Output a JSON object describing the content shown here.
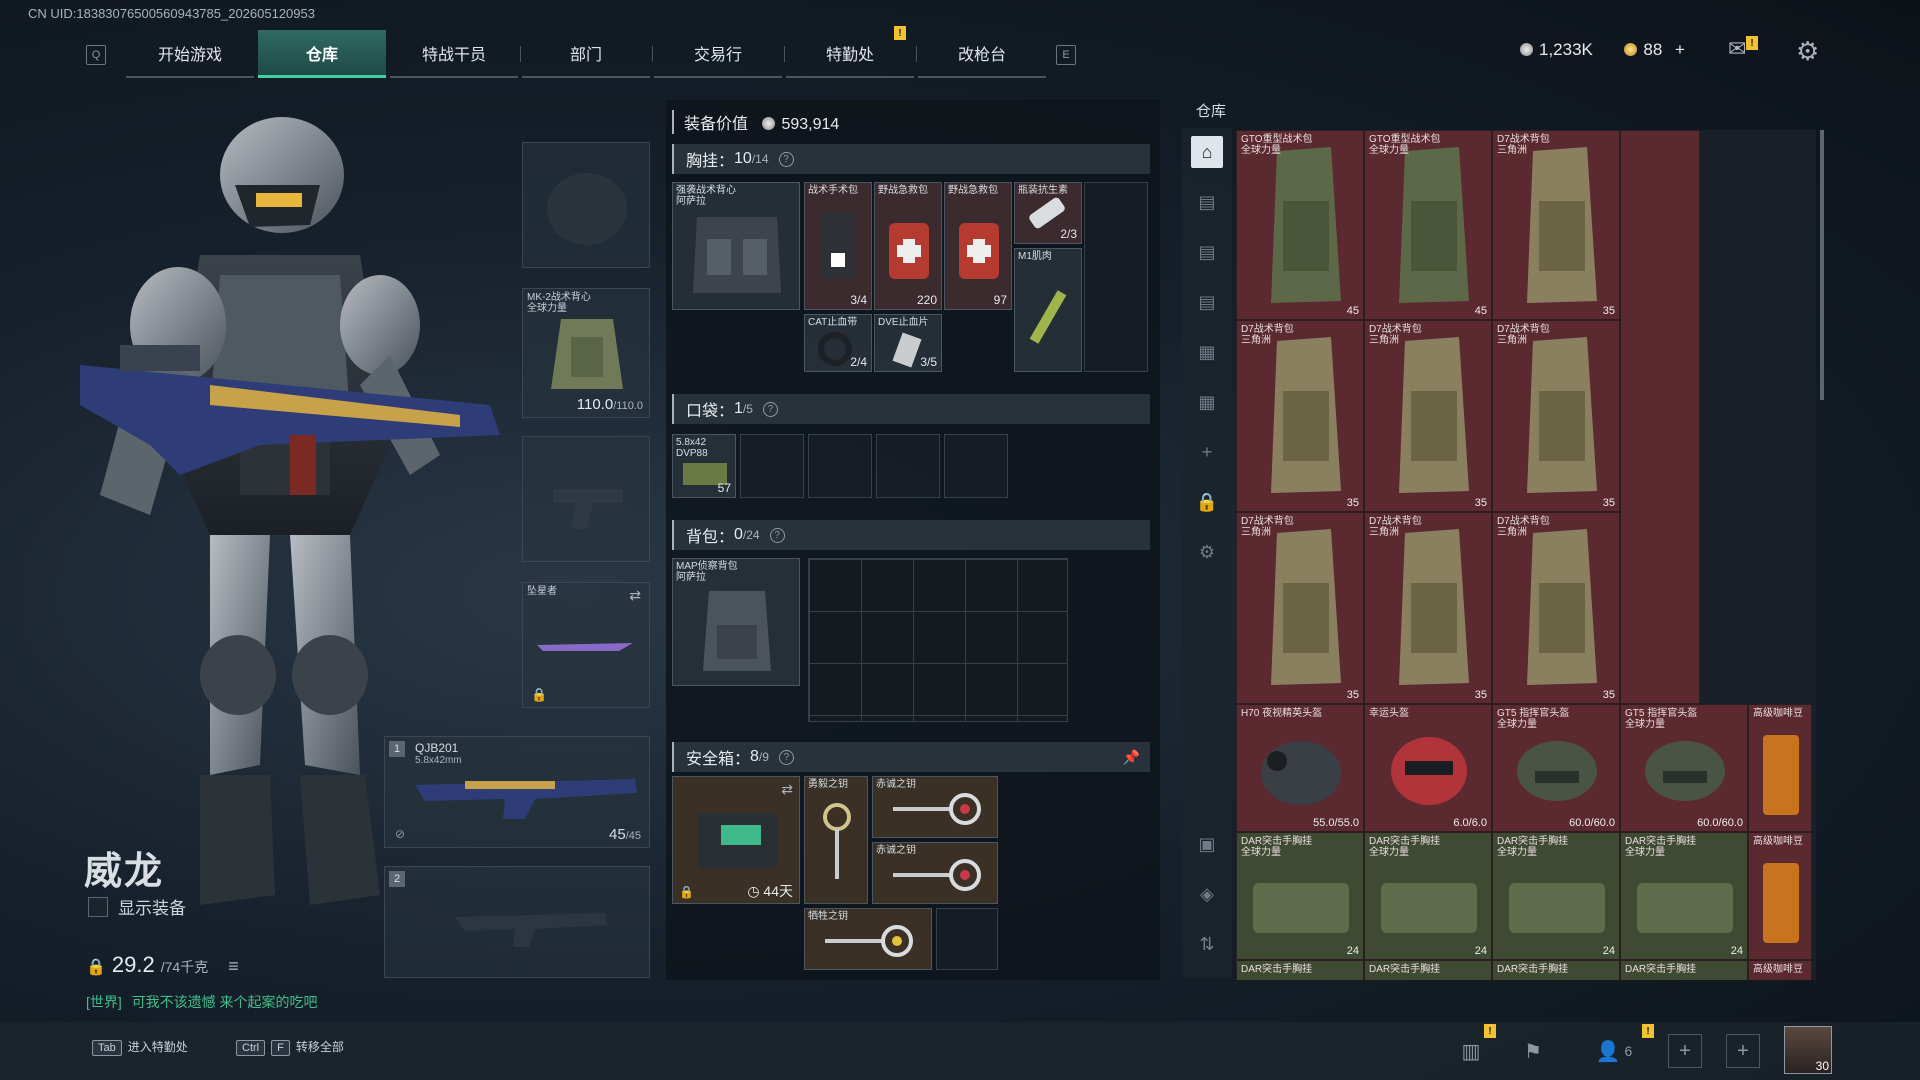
{
  "uid": "CN UID:18383076500560943785_202605120953",
  "nav": {
    "left_key": "Q",
    "right_key": "E",
    "tabs": [
      "开始游戏",
      "仓库",
      "特战干员",
      "部门",
      "交易行",
      "特勤处",
      "改枪台"
    ],
    "active": "仓库"
  },
  "currency": {
    "silver": "1,233K",
    "gold": "88",
    "plus": "+"
  },
  "character": {
    "name": "威龙",
    "show_equipment": "显示装备",
    "weight": "29.2",
    "weight_max": "/74千克",
    "chat_channel": "[世界]",
    "chat_text": "可我不该遗憾 来个起案的吃吧"
  },
  "equip_slots": {
    "vest_name": "MK-2战术背心\n全球力量",
    "vest_durability": "110.0",
    "vest_durability_max": "/110.0",
    "melee_name": "坠星者",
    "primary_index": "1",
    "primary_name": "QJB201",
    "primary_caliber": "5.8x42mm",
    "primary_ammo": "45",
    "primary_ammo_max": "/45",
    "secondary_index": "2"
  },
  "equip_value": {
    "label": "装备价值",
    "value": "593,914"
  },
  "chest": {
    "label": "胸挂：",
    "used": "10",
    "cap": "/14",
    "rig_name": "强袭战术背心\n阿萨拉",
    "items": [
      {
        "name": "战术手术包",
        "count": "3/4"
      },
      {
        "name": "野战急救包",
        "count": "220"
      },
      {
        "name": "野战急救包",
        "count": "97"
      },
      {
        "name": "瓶装抗生素",
        "count": "2/3"
      },
      {
        "name": "CAT止血带",
        "count": "2/4"
      },
      {
        "name": "DVE止血片",
        "count": "3/5"
      },
      {
        "name": "M1肌肉",
        "count": ""
      }
    ]
  },
  "pocket": {
    "label": "口袋：",
    "used": "1",
    "cap": "/5",
    "ammo_name": "5.8x42\nDVP88",
    "ammo_count": "57"
  },
  "backpack": {
    "label": "背包：",
    "used": "0",
    "cap": "/24",
    "bag_name": "MAP侦察背包\n阿萨拉"
  },
  "safebox": {
    "label": "安全箱：",
    "used": "8",
    "cap": "/9",
    "days": "44天",
    "keys": [
      "勇毅之钥",
      "赤诚之钥",
      "赤诚之钥",
      "牺牲之钥"
    ]
  },
  "warehouse": {
    "title": "仓库",
    "rows": [
      [
        {
          "name": "GTO重型战术包\n全球力量",
          "count": "45"
        },
        {
          "name": "GTO重型战术包\n全球力量",
          "count": "45"
        },
        {
          "name": "D7战术背包\n三角洲",
          "count": "35"
        }
      ],
      [
        {
          "name": "D7战术背包\n三角洲",
          "count": "35"
        },
        {
          "name": "D7战术背包\n三角洲",
          "count": "35"
        },
        {
          "name": "D7战术背包\n三角洲",
          "count": "35"
        }
      ],
      [
        {
          "name": "D7战术背包\n三角洲",
          "count": "35"
        },
        {
          "name": "D7战术背包\n三角洲",
          "count": "35"
        },
        {
          "name": "D7战术背包\n三角洲",
          "count": "35"
        }
      ]
    ],
    "helmets": [
      {
        "name": "H70 夜视精英头盔",
        "count": "55.0/55.0"
      },
      {
        "name": "幸运头盔",
        "count": "6.0/6.0"
      },
      {
        "name": "GT5 指挥官头盔\n全球力量",
        "count": "60.0/60.0"
      },
      {
        "name": "GT5 指挥官头盔\n全球力量",
        "count": "60.0/60.0"
      },
      {
        "name": "高级咖啡豆",
        "count": ""
      }
    ],
    "rigs": [
      {
        "name": "DAR突击手胸挂\n全球力量",
        "count": "24"
      },
      {
        "name": "DAR突击手胸挂\n全球力量",
        "count": "24"
      },
      {
        "name": "DAR突击手胸挂\n全球力量",
        "count": "24"
      },
      {
        "name": "DAR突击手胸挂\n全球力量",
        "count": "24"
      },
      {
        "name": "高级咖啡豆",
        "count": ""
      }
    ],
    "partial_row": [
      "DAR突击手胸挂",
      "DAR突击手胸挂",
      "DAR突击手胸挂",
      "DAR突击手胸挂",
      "高级咖啡豆"
    ]
  },
  "bottom": {
    "hint1_key": "Tab",
    "hint1_text": "进入特勤处",
    "hint2_key1": "Ctrl",
    "hint2_key2": "F",
    "hint2_text": "转移全部",
    "friends_count": "6",
    "level": "30"
  },
  "colors": {
    "accent": "#3fd1a5",
    "warehouse_red": "#5b2a30",
    "warehouse_green": "#3e4a32",
    "alert": "#f2c230"
  }
}
